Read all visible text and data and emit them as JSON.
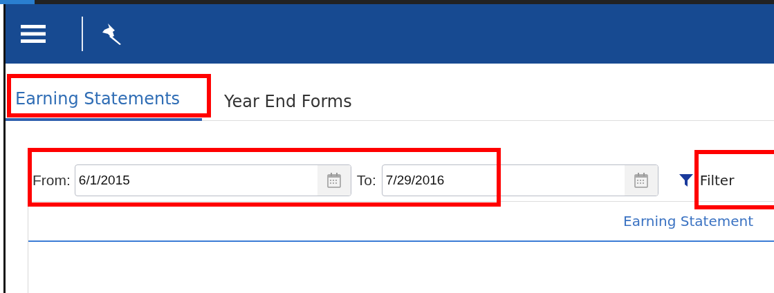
{
  "tabs": [
    {
      "label": "Earning Statements",
      "selected": true,
      "highlighted": true
    },
    {
      "label": "Year End Forms",
      "selected": false,
      "highlighted": false
    }
  ],
  "date_range": {
    "highlighted": true,
    "from_label": "From:",
    "from_value": "6/1/2015",
    "to_label": "To:",
    "to_value": "7/29/2016"
  },
  "filter_button": {
    "label": "Filter",
    "highlighted": true
  },
  "table": {
    "columns": [
      "Earning Statement"
    ]
  }
}
